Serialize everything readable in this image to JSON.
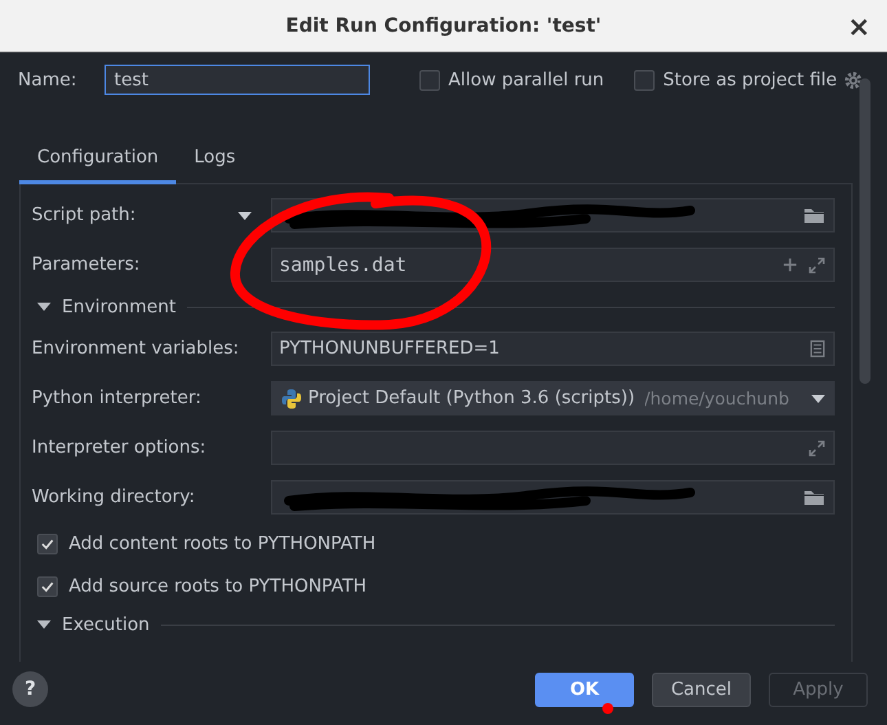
{
  "window": {
    "title": "Edit Run Configuration: 'test'",
    "close": "×"
  },
  "name_row": {
    "label": "Name:",
    "value": "test",
    "options": [
      {
        "label": "Allow parallel run",
        "checked": false
      },
      {
        "label": "Store as project file",
        "checked": false
      }
    ]
  },
  "tabs": [
    {
      "label": "Configuration",
      "selected": true
    },
    {
      "label": "Logs",
      "selected": false
    }
  ],
  "rows": [
    {
      "kind": "script",
      "label": "Script path:",
      "redacted": true
    },
    {
      "kind": "params",
      "label": "Parameters:",
      "value": "samples.dat"
    },
    {
      "kind": "section",
      "label": "Environment",
      "expanded": true
    },
    {
      "kind": "env",
      "label": "Environment variables:",
      "value": "PYTHONUNBUFFERED=1"
    },
    {
      "kind": "interpreter",
      "label": "Python interpreter:",
      "value": "Project Default (Python 3.6 (scripts))",
      "hint": "/home/youchunb"
    },
    {
      "kind": "expand",
      "label": "Interpreter options:"
    },
    {
      "kind": "path",
      "label": "Working directory:",
      "redacted": true
    },
    {
      "kind": "check",
      "label": "Add content roots to PYTHONPATH",
      "checked": true
    },
    {
      "kind": "check",
      "label": "Add source roots to PYTHONPATH",
      "checked": true
    },
    {
      "kind": "section",
      "label": "Execution",
      "expanded": true
    }
  ],
  "buttons": [
    {
      "label": "OK",
      "kind": "primary"
    },
    {
      "label": "Cancel",
      "kind": "normal"
    },
    {
      "label": "Apply",
      "kind": "disabled"
    }
  ],
  "help": "?"
}
